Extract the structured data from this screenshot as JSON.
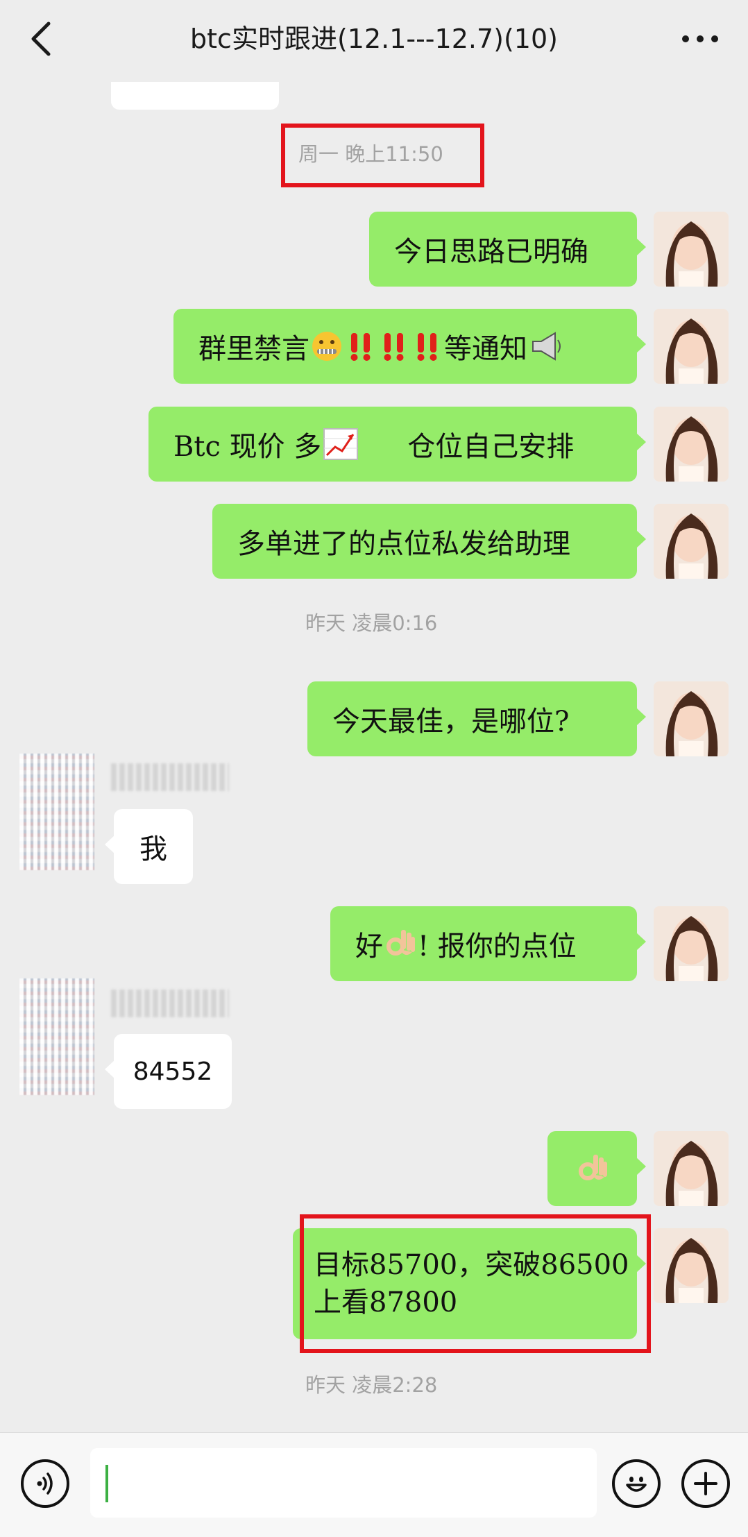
{
  "header": {
    "title": "btc实时跟进(12.1---12.7)(10)",
    "back_icon": "chevron-left-icon",
    "more_icon": "more-dots-icon"
  },
  "messages": {
    "time1": "周一 晚上11:50",
    "m1": "今日思路已明确",
    "m2_text1": "群里禁言",
    "m2_text2": "等通知",
    "m3_text1": "Btc 现价 多",
    "m3_text2": "仓位自己安排",
    "m4": "多单进了的点位私发给助理",
    "time2": "昨天 凌晨0:16",
    "m5": "今天最佳，是哪位?",
    "in1": "我",
    "m6_text1": "好",
    "m6_text2": "! 报你的点位",
    "in2": "84552",
    "m8_line1": "目标85700，突破86500",
    "m8_line2": "上看87800",
    "time3": "昨天 凌晨2:28"
  },
  "bottom": {
    "voice_icon": "voice-icon",
    "emoji_icon": "smiley-icon",
    "plus_icon": "plus-icon"
  },
  "colors": {
    "outgoing_bubble": "#95ec69",
    "incoming_bubble": "#ffffff",
    "background": "#ededed",
    "highlight_box": "#e3141c",
    "caret": "#3cb043"
  }
}
